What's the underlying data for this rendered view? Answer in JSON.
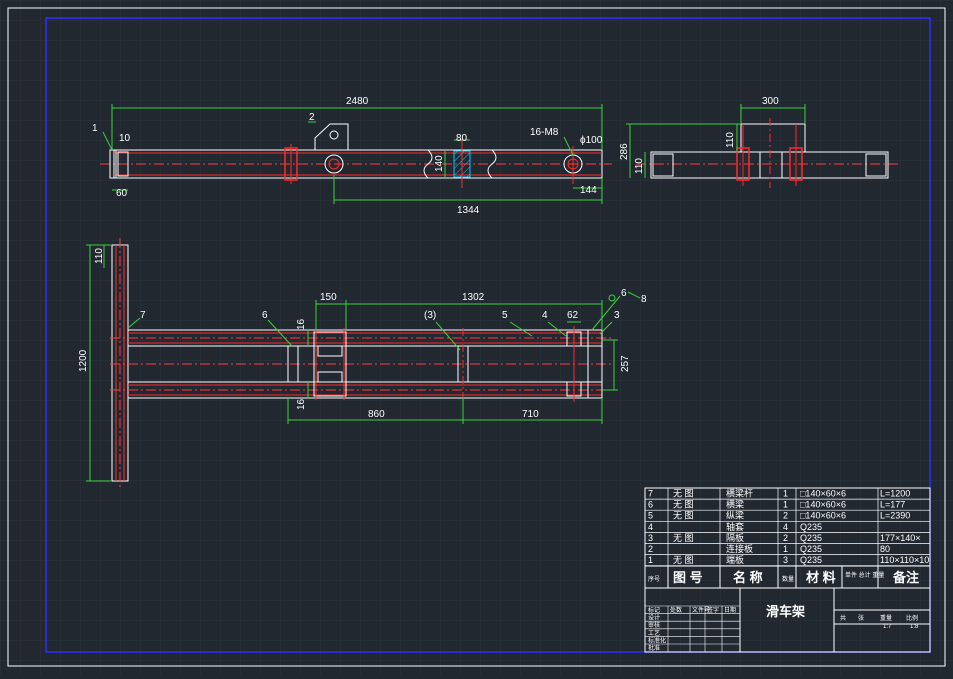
{
  "colors": {
    "background": "#212830",
    "grid": "#2f3946",
    "frame": "#2d2dff",
    "outline": "#ffffff",
    "member": "#ff2a2a",
    "centerline": "#ff3b3b",
    "dimension": "#3cd23c",
    "hatch": "#00c8ff"
  },
  "top_view": {
    "dims": {
      "overall_length": "2480",
      "end_offset": "10",
      "end_width": "60",
      "section_80": "80",
      "section_height": "140",
      "hole_span": "1344",
      "bolt_spec": "16-M8",
      "hole_dia": "ϕ100",
      "end_144": "144"
    },
    "leaders": {
      "p1": "1",
      "p2": "2"
    }
  },
  "side_view": {
    "dims": {
      "width_300": "300",
      "h110_top": "110",
      "h286": "286",
      "h110_left": "110"
    }
  },
  "plan_view": {
    "dims": {
      "d110": "110",
      "d1200": "1200",
      "d150": "150",
      "d1302": "1302",
      "d16_top": "16",
      "d16_bot": "16",
      "d257": "257",
      "d62": "62",
      "d860": "860",
      "d710": "710"
    },
    "leaders": {
      "p7": "7",
      "p6": "6",
      "p3b": "(3)",
      "p5": "5",
      "p4": "4",
      "p3": "3",
      "p6b": "6",
      "p8": "8"
    }
  },
  "title_block": {
    "bom_rows": [
      {
        "no": "7",
        "drawing": "无  图",
        "name": "横梁杆",
        "qty": "1",
        "material": "□140×60×6",
        "note": "L=1200"
      },
      {
        "no": "6",
        "drawing": "无  图",
        "name": "横梁",
        "qty": "1",
        "material": "□140×60×6",
        "note": "L=177"
      },
      {
        "no": "5",
        "drawing": "无  图",
        "name": "纵梁",
        "qty": "2",
        "material": "□140×60×6",
        "note": "L=2390"
      },
      {
        "no": "4",
        "drawing": "",
        "name": "轴套",
        "qty": "4",
        "material": "Q235",
        "note": ""
      },
      {
        "no": "3",
        "drawing": "无  图",
        "name": "隔板",
        "qty": "2",
        "material": "Q235",
        "note": "177×140×"
      },
      {
        "no": "2",
        "drawing": "",
        "name": "连接板",
        "qty": "1",
        "material": "Q235",
        "note": "80"
      },
      {
        "no": "1",
        "drawing": "无  图",
        "name": "端板",
        "qty": "3",
        "material": "Q235",
        "note": "110×110×10"
      }
    ],
    "header": {
      "no": "序号",
      "drawing": "图  号",
      "name": "名  称",
      "qty": "数量",
      "material": "材  料",
      "weight": "单件 总计\n重量",
      "note": "备注"
    },
    "drawing_title": "滑车架",
    "sign_rows": [
      "标记",
      "设计",
      "审核",
      "工艺",
      "标准化",
      "批准"
    ],
    "sign_cols": [
      "处数",
      "文件号",
      "签字",
      "日期"
    ],
    "info_labels": [
      "共",
      "张",
      "重量",
      "比例"
    ],
    "info_values": [
      "1:7",
      "1:8"
    ]
  }
}
